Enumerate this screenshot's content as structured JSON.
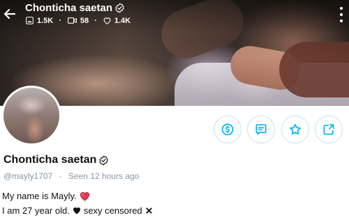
{
  "header": {
    "title": "Chonticha saetan",
    "stats": {
      "media_count": "1.5K",
      "video_count": "58",
      "likes_count": "1.4K"
    }
  },
  "profile": {
    "name": "Chonticha saetan",
    "handle": "@mayly1707",
    "seen_label": "Seen",
    "seen_time": "12 hours ago",
    "bio_line1": "My name is Mayly.",
    "bio_line2": "I am 27 year old.",
    "bio_line2_tail": "sexy censored"
  },
  "icons": {
    "back": "arrow-left-icon",
    "verified": "verified-badge-icon",
    "media": "image-icon",
    "video": "video-icon",
    "likes": "heart-icon",
    "menu": "kebab-menu-icon",
    "tip": "dollar-icon",
    "message": "message-icon",
    "favorite": "star-icon",
    "share": "share-icon"
  },
  "colors": {
    "accent": "#00aff0",
    "muted_text": "#8a96a3",
    "heart_red": "#e53950"
  }
}
